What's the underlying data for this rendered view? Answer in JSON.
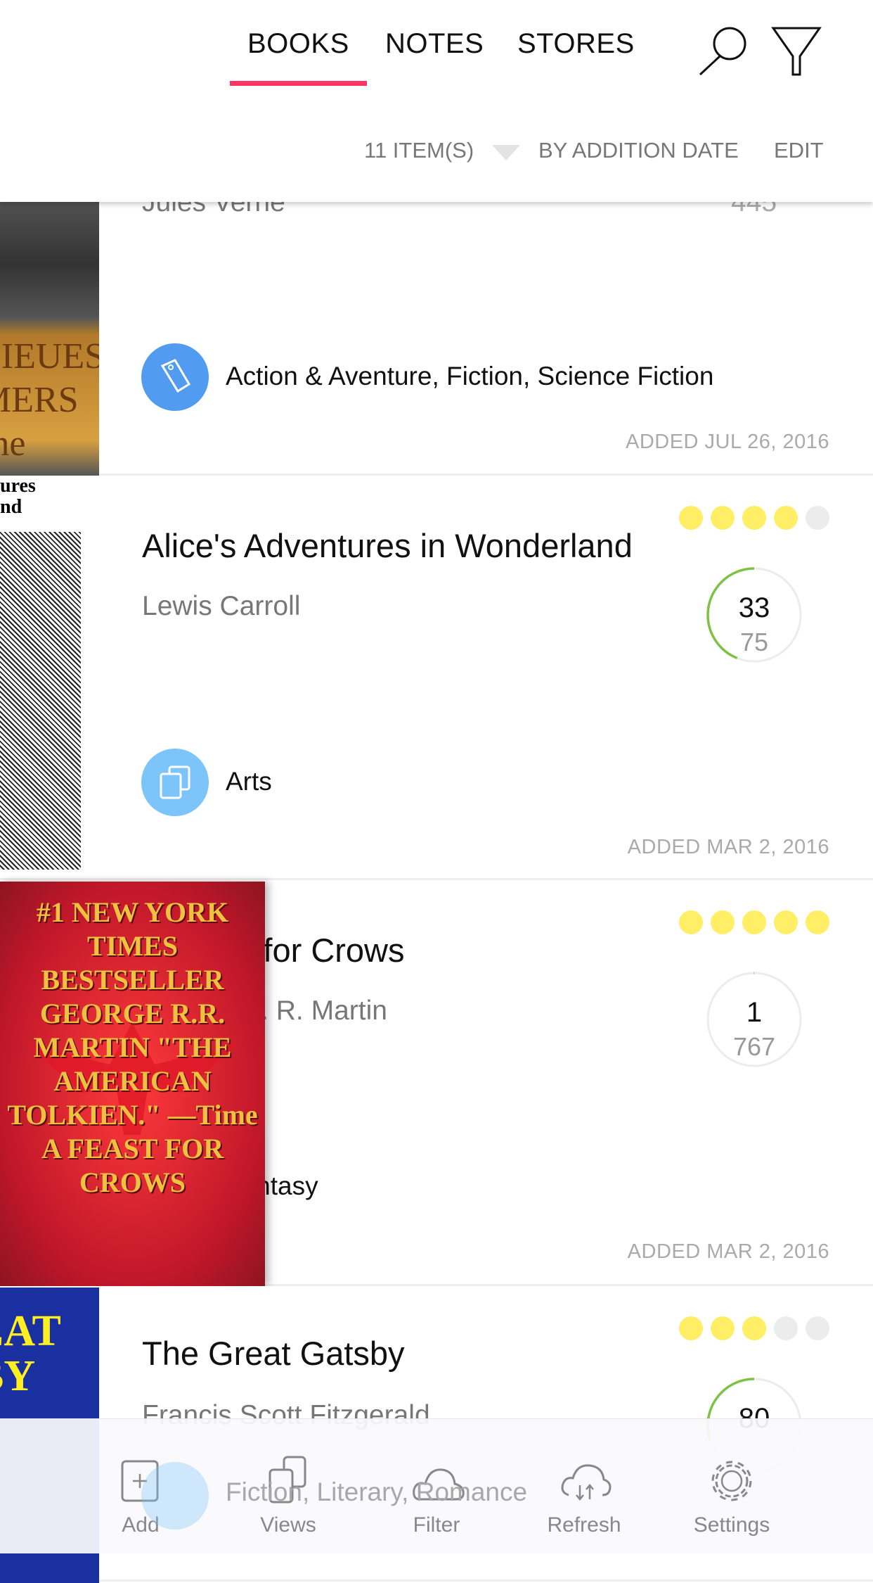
{
  "header": {
    "tabs": [
      {
        "label": "BOOKS",
        "active": true
      },
      {
        "label": "NOTES"
      },
      {
        "label": "STORES"
      }
    ],
    "accent": "#fc3464",
    "icons": [
      "search-icon",
      "filter-icon"
    ],
    "item_count": "11 ITEM(S)",
    "sort_label": "BY ADDITION DATE",
    "edit_label": "EDIT"
  },
  "books": [
    {
      "author": "Jules Verne",
      "pages": "445",
      "categories": "Action & Aventure, Fiction, Science Fiction",
      "category_icon": "tag-icon",
      "category_color": "#519cf0",
      "added": "ADDED JUL 26, 2016",
      "cover_text": "LIEUES MERS rne"
    },
    {
      "title": "Alice's Adventures in Wonderland",
      "author": "Lewis Carroll",
      "rating": 4,
      "rating_max": 5,
      "current_page": "33",
      "total_pages": "75",
      "progress": 0.44,
      "categories": "Arts",
      "category_icon": "views-icon",
      "category_color": "#7cc4fa",
      "added": "ADDED MAR 2, 2016",
      "cover_text": "ures nd"
    },
    {
      "title": "A Feast for Crows",
      "author": "George R. R. Martin",
      "rating": 5,
      "rating_max": 5,
      "current_page": "1",
      "total_pages": "767",
      "progress": 0.0013,
      "categories": "Fantasy",
      "category_color": "#7cc4fa",
      "added": "ADDED MAR 2, 2016",
      "cover_text": "#1 NEW YORK TIMES BESTSELLER GEORGE R.R. MARTIN \"THE AMERICAN TOLKIEN.\" —Time A FEAST FOR CROWS"
    },
    {
      "title": "The Great Gatsby",
      "author": "Francis Scott Fitzgerald",
      "rating": 3,
      "rating_max": 5,
      "current_page": "80",
      "progress": 0.3,
      "categories": "Fiction, Literary, Romance",
      "category_color": "#7cc4fa",
      "cover_text": "EAT BY"
    }
  ],
  "colors": {
    "rating_on": "#ffee66",
    "rating_off": "#ececec",
    "progress": "#7dc242"
  },
  "toolbar": [
    {
      "label": "Add",
      "icon": "add-icon"
    },
    {
      "label": "Views",
      "icon": "views-icon"
    },
    {
      "label": "Filter",
      "icon": "cloud-icon"
    },
    {
      "label": "Refresh",
      "icon": "cloud-sync-icon"
    },
    {
      "label": "Settings",
      "icon": "gear-icon"
    }
  ]
}
